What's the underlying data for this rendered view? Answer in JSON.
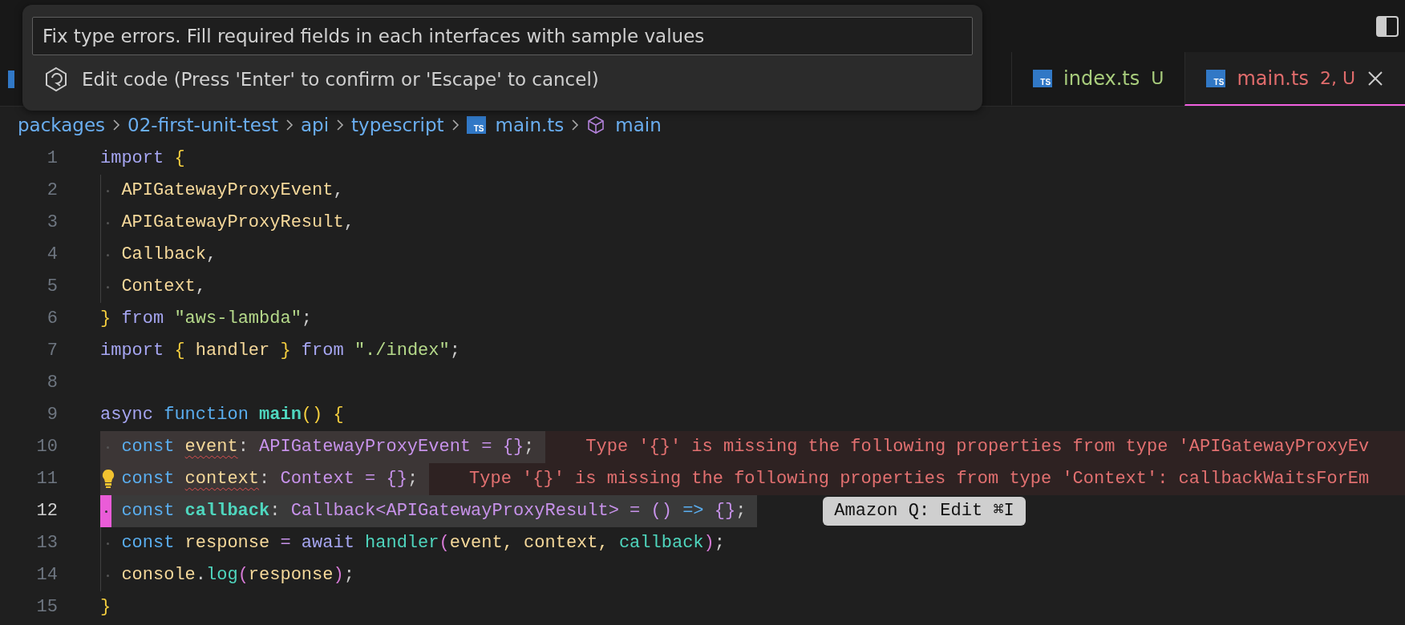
{
  "quick_input": {
    "value": "Fix type errors. Fill required fields in each interfaces with sample values",
    "hint": "Edit code (Press 'Enter' to confirm or 'Escape' to cancel)"
  },
  "tabs": [
    {
      "icon_label": "TS",
      "label": "index.ts",
      "badge": "U",
      "color": "#a8cc7c",
      "selected": false
    },
    {
      "icon_label": "TS",
      "label": "main.ts",
      "badge": "2, U",
      "color": "#e06c6c",
      "selected": true
    }
  ],
  "breadcrumb": [
    {
      "label": "packages",
      "kind": "folder"
    },
    {
      "label": "02-first-unit-test",
      "kind": "folder"
    },
    {
      "label": "api",
      "kind": "folder"
    },
    {
      "label": "typescript",
      "kind": "folder"
    },
    {
      "label": "main.ts",
      "kind": "file",
      "icon_label": "TS"
    },
    {
      "label": "main",
      "kind": "symbol"
    }
  ],
  "lines": [
    {
      "number": "1",
      "indent": false,
      "selected": false,
      "current": false,
      "lightbulb": false,
      "tokens": [
        {
          "text": "import",
          "kind": "kw"
        },
        {
          "text": " {",
          "kind": "brace"
        }
      ]
    },
    {
      "number": "2",
      "indent": true,
      "selected": false,
      "current": false,
      "lightbulb": false,
      "tokens": [
        {
          "text": "APIGatewayProxyEvent",
          "kind": "var"
        },
        {
          "text": ",",
          "kind": "punct"
        }
      ]
    },
    {
      "number": "3",
      "indent": true,
      "selected": false,
      "current": false,
      "lightbulb": false,
      "tokens": [
        {
          "text": "APIGatewayProxyResult",
          "kind": "var"
        },
        {
          "text": ",",
          "kind": "punct"
        }
      ]
    },
    {
      "number": "4",
      "indent": true,
      "selected": false,
      "current": false,
      "lightbulb": false,
      "tokens": [
        {
          "text": "Callback",
          "kind": "var"
        },
        {
          "text": ",",
          "kind": "punct"
        }
      ]
    },
    {
      "number": "5",
      "indent": true,
      "selected": false,
      "current": false,
      "lightbulb": false,
      "tokens": [
        {
          "text": "Context",
          "kind": "var"
        },
        {
          "text": ",",
          "kind": "punct"
        }
      ]
    },
    {
      "number": "6",
      "indent": false,
      "selected": false,
      "current": false,
      "lightbulb": false,
      "tokens": [
        {
          "text": "}",
          "kind": "brace"
        },
        {
          "text": " from ",
          "kind": "kw"
        },
        {
          "text": "\"aws-lambda\"",
          "kind": "str"
        },
        {
          "text": ";",
          "kind": "punct"
        }
      ]
    },
    {
      "number": "7",
      "indent": false,
      "selected": false,
      "current": false,
      "lightbulb": false,
      "tokens": [
        {
          "text": "import",
          "kind": "kw"
        },
        {
          "text": " { ",
          "kind": "brace"
        },
        {
          "text": "handler ",
          "kind": "var"
        },
        {
          "text": "}",
          "kind": "brace"
        },
        {
          "text": " from ",
          "kind": "kw"
        },
        {
          "text": "\"./index\"",
          "kind": "str"
        },
        {
          "text": ";",
          "kind": "punct"
        }
      ]
    },
    {
      "number": "8",
      "indent": false,
      "selected": false,
      "current": false,
      "lightbulb": false
    },
    {
      "number": "9",
      "indent": false,
      "selected": false,
      "current": false,
      "lightbulb": false,
      "tokens": [
        {
          "text": "async",
          "kind": "kw"
        },
        {
          "text": " function ",
          "kind": "storage"
        },
        {
          "text": "main",
          "kind": "fnbold"
        },
        {
          "text": "() {",
          "kind": "brace"
        }
      ]
    },
    {
      "number": "10",
      "indent": true,
      "selected": true,
      "current": false,
      "lightbulb": false,
      "error": "Type '{}' is missing the following properties from type 'APIGatewayProxyEv",
      "tokens": [
        {
          "text": "const ",
          "kind": "storage"
        },
        {
          "text": "event",
          "kind": "var",
          "squiggle": true
        },
        {
          "text": ": ",
          "kind": "punct"
        },
        {
          "text": "APIGatewayProxyEvent = {}",
          "kind": "type"
        },
        {
          "text": ";",
          "kind": "punct"
        }
      ]
    },
    {
      "number": "11",
      "indent": true,
      "selected": true,
      "current": false,
      "lightbulb": true,
      "error": "Type '{}' is missing the following properties from type 'Context': callbackWaitsForEm",
      "tokens": [
        {
          "text": "const ",
          "kind": "storage"
        },
        {
          "text": "context",
          "kind": "var",
          "squiggle": true
        },
        {
          "text": ": ",
          "kind": "punct"
        },
        {
          "text": "Context = {}",
          "kind": "type"
        },
        {
          "text": ";",
          "kind": "punct"
        }
      ]
    },
    {
      "number": "12",
      "indent": true,
      "selected": true,
      "current": true,
      "lightbulb": false,
      "hint": "Amazon Q: Edit ⌘I",
      "tokens": [
        {
          "text": "const ",
          "kind": "storage"
        },
        {
          "text": "callback",
          "kind": "fnbold"
        },
        {
          "text": ": ",
          "kind": "punct"
        },
        {
          "text": "Callback<APIGatewayProxyResult> = () ",
          "kind": "type"
        },
        {
          "text": "=>",
          "kind": "storage"
        },
        {
          "text": " {}",
          "kind": "type"
        },
        {
          "text": ";",
          "kind": "punct"
        }
      ]
    },
    {
      "number": "13",
      "indent": true,
      "selected": false,
      "current": false,
      "lightbulb": false,
      "tokens": [
        {
          "text": "const ",
          "kind": "storage"
        },
        {
          "text": "response ",
          "kind": "var"
        },
        {
          "text": "= ",
          "kind": "type"
        },
        {
          "text": "await ",
          "kind": "kw"
        },
        {
          "text": "handler",
          "kind": "fn"
        },
        {
          "text": "(",
          "kind": "paren"
        },
        {
          "text": "event, context, ",
          "kind": "var"
        },
        {
          "text": "callback",
          "kind": "fn"
        },
        {
          "text": ")",
          "kind": "paren"
        },
        {
          "text": ";",
          "kind": "punct"
        }
      ]
    },
    {
      "number": "14",
      "indent": true,
      "selected": false,
      "current": false,
      "lightbulb": false,
      "tokens": [
        {
          "text": "console",
          "kind": "var"
        },
        {
          "text": ".",
          "kind": "punct"
        },
        {
          "text": "log",
          "kind": "fn"
        },
        {
          "text": "(",
          "kind": "paren"
        },
        {
          "text": "response",
          "kind": "var"
        },
        {
          "text": ")",
          "kind": "paren"
        },
        {
          "text": ";",
          "kind": "punct"
        }
      ]
    },
    {
      "number": "15",
      "indent": false,
      "selected": false,
      "current": false,
      "lightbulb": false,
      "tokens": [
        {
          "text": "}",
          "kind": "brace"
        }
      ]
    }
  ]
}
